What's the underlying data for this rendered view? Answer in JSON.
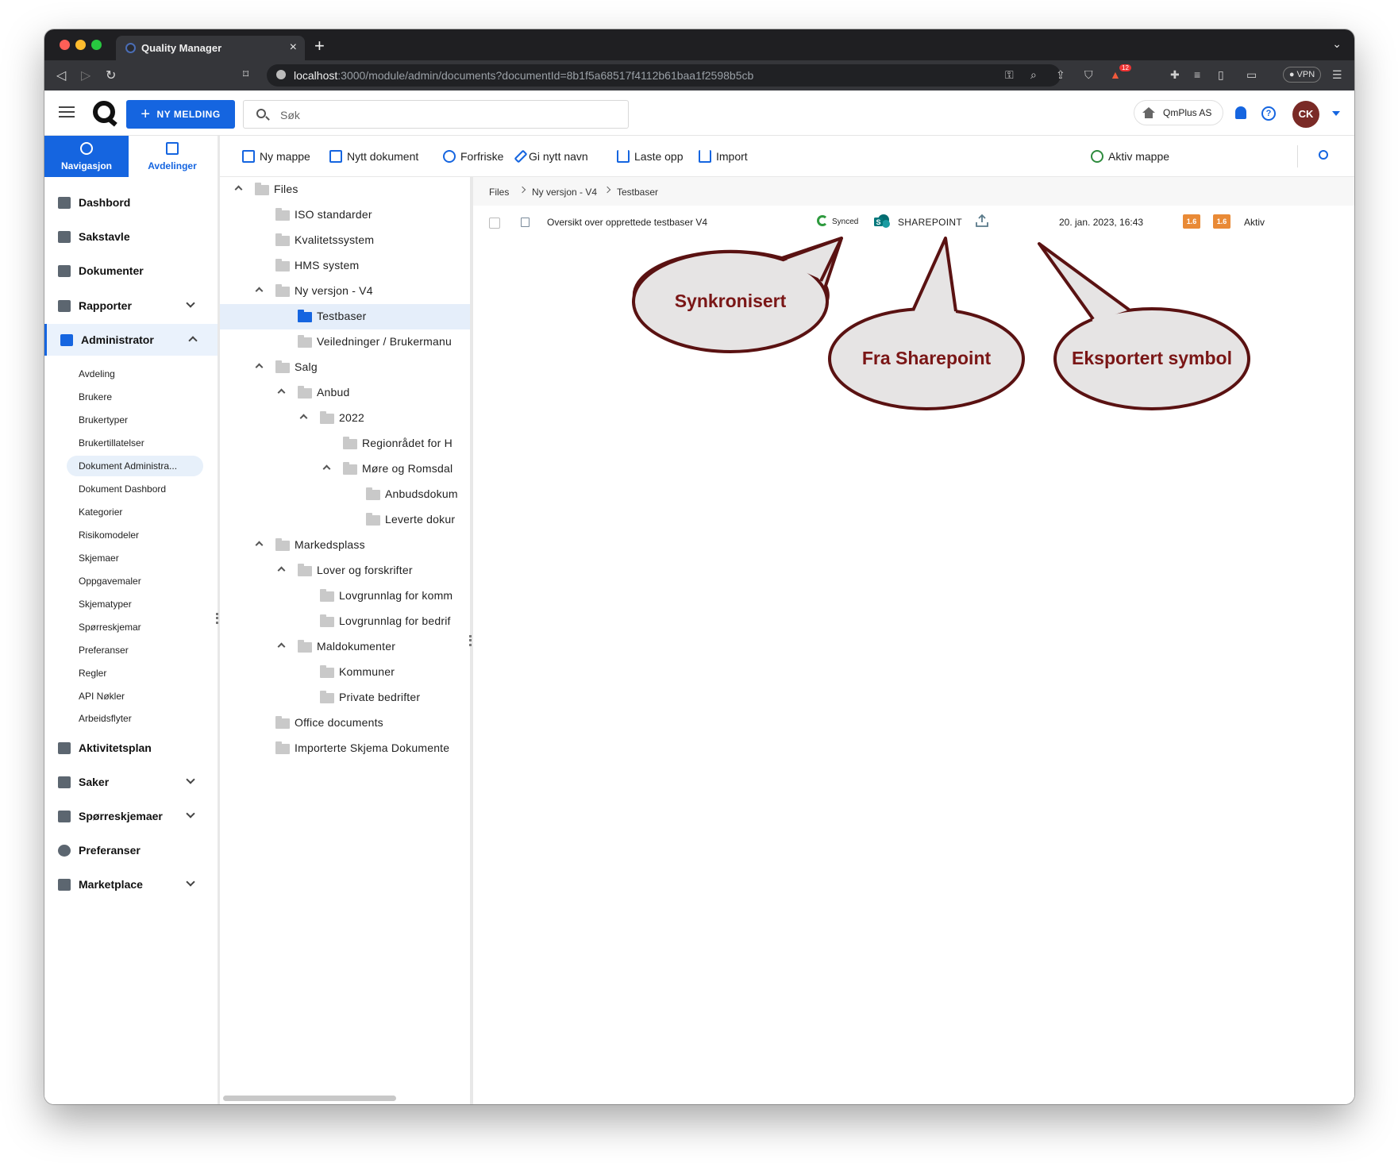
{
  "browser": {
    "tab_title": "Quality Manager",
    "url_host": "localhost",
    "url_path": ":3000/module/admin/documents?documentId=8b1f5a68517f4112b61baa1f2598b5cb",
    "vpn_label": "VPN",
    "badge_count": "12"
  },
  "header": {
    "new_message_label": "NY MELDING",
    "search_placeholder": "Søk",
    "company_label": "QmPlus AS",
    "avatar_initials": "CK",
    "accent_color": "#1565e0",
    "avatar_color": "#7a2a26"
  },
  "sidebar": {
    "tabs": [
      {
        "label": "Navigasjon",
        "icon": "compass-icon"
      },
      {
        "label": "Avdelinger",
        "icon": "org-chart-icon"
      }
    ],
    "items": [
      {
        "label": "Dashbord",
        "icon": "dashboard-icon"
      },
      {
        "label": "Sakstavle",
        "icon": "board-icon"
      },
      {
        "label": "Dokumenter",
        "icon": "folder-icon"
      },
      {
        "label": "Rapporter",
        "icon": "chart-icon"
      },
      {
        "label": "Administrator",
        "icon": "admin-gear-icon"
      },
      {
        "label": "Aktivitetsplan",
        "icon": "calendar-icon"
      },
      {
        "label": "Saker",
        "icon": "cases-icon"
      },
      {
        "label": "Spørreskjemaer",
        "icon": "questionnaire-icon"
      },
      {
        "label": "Preferanser",
        "icon": "gear-icon"
      },
      {
        "label": "Marketplace",
        "icon": "store-icon"
      }
    ],
    "admin_subitems": [
      "Avdeling",
      "Brukere",
      "Brukertyper",
      "Brukertillatelser",
      "Dokument Administra...",
      "Dokument Dashbord",
      "Kategorier",
      "Risikomodeler",
      "Skjemaer",
      "Oppgavemaler",
      "Skjematyper",
      "Spørreskjemar",
      "Preferanser",
      "Regler",
      "API Nøkler",
      "Arbeidsflyter"
    ]
  },
  "toolbar": {
    "new_folder": "Ny mappe",
    "new_document": "Nytt dokument",
    "refresh": "Forfriske",
    "rename": "Gi nytt navn",
    "upload": "Laste opp",
    "import": "Import",
    "active_folder": "Aktiv mappe"
  },
  "tree": [
    {
      "label": "Files"
    },
    {
      "label": "ISO standarder"
    },
    {
      "label": "Kvalitetssystem"
    },
    {
      "label": "HMS system"
    },
    {
      "label": "Ny versjon - V4"
    },
    {
      "label": "Testbaser"
    },
    {
      "label": "Veiledninger / Brukermanu"
    },
    {
      "label": "Salg"
    },
    {
      "label": "Anbud"
    },
    {
      "label": "2022"
    },
    {
      "label": "Regionrådet for H"
    },
    {
      "label": "Møre og Romsdal"
    },
    {
      "label": "Anbudsdokum"
    },
    {
      "label": "Leverte dokur"
    },
    {
      "label": "Markedsplass"
    },
    {
      "label": "Lover og forskrifter"
    },
    {
      "label": "Lovgrunnlag for komm"
    },
    {
      "label": "Lovgrunnlag for bedrif"
    },
    {
      "label": "Maldokumenter"
    },
    {
      "label": "Kommuner"
    },
    {
      "label": "Private bedrifter"
    },
    {
      "label": "Office documents"
    },
    {
      "label": "Importerte Skjema Dokumente"
    }
  ],
  "breadcrumb": [
    "Files",
    "Ny versjon - V4",
    "Testbaser"
  ],
  "document": {
    "title": "Oversikt over opprettede testbaser V4",
    "sync_status": "Synced",
    "source": "SHAREPOINT",
    "date": "20. jan. 2023, 16:43",
    "version_1": "1.6",
    "version_2": "1.6",
    "status": "Aktiv",
    "version_badge_color": "#e98a36"
  },
  "callouts": {
    "synced": "Synkronisert",
    "sharepoint": "Fra Sharepoint",
    "exported": "Eksportert symbol",
    "fill_color": "#e6e4e4",
    "border_color": "#5a1212",
    "text_color": "#7a1616"
  }
}
